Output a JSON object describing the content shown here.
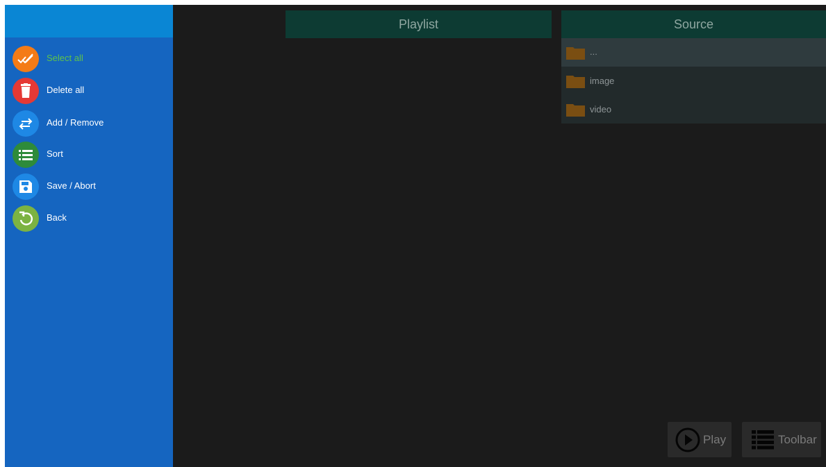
{
  "sidebar": {
    "items": [
      {
        "label": "Select all",
        "icon": "double-check-icon",
        "color": "#f47b16",
        "label_color": "#5fc34a"
      },
      {
        "label": "Delete all",
        "icon": "trash-icon",
        "color": "#e53935"
      },
      {
        "label": "Add / Remove",
        "icon": "swap-arrows-icon",
        "color": "#1e88e5"
      },
      {
        "label": "Sort",
        "icon": "list-icon",
        "color": "#2e8b3a"
      },
      {
        "label": "Save / Abort",
        "icon": "save-icon",
        "color": "#1e88e5"
      },
      {
        "label": "Back",
        "icon": "undo-icon",
        "color": "#7cb342"
      }
    ]
  },
  "playlist": {
    "title": "Playlist"
  },
  "source": {
    "title": "Source",
    "items": [
      {
        "label": "...",
        "icon": "folder-icon"
      },
      {
        "label": "image",
        "icon": "folder-icon"
      },
      {
        "label": "video",
        "icon": "folder-icon"
      }
    ]
  },
  "buttons": {
    "play": {
      "label": "Play",
      "icon": "play-icon"
    },
    "toolbar": {
      "label": "Toolbar",
      "icon": "toolbar-icon"
    }
  },
  "colors": {
    "sidebar_bg": "#1565c0",
    "sidebar_header": "#0a86d4",
    "panel_header": "#0d3b33",
    "folder": "#7a4e12",
    "background": "#1b1b1b"
  }
}
